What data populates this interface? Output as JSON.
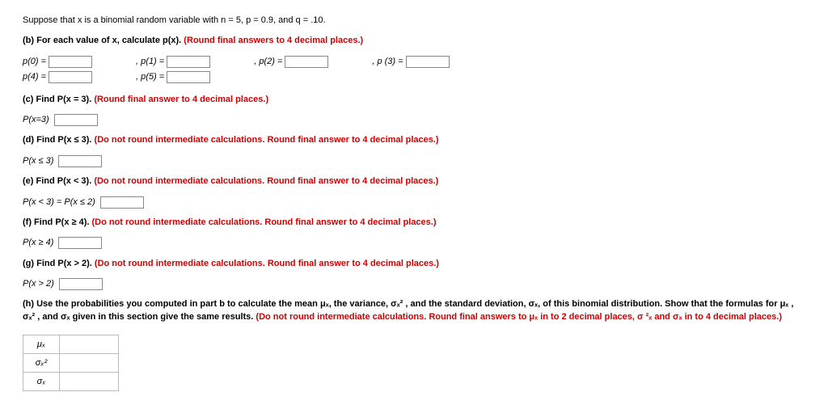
{
  "problem": {
    "intro": "Suppose that x is a binomial random variable with n = 5, p = 0.9, and q = .10.",
    "b": {
      "prompt": "(b) For each value of x, calculate p(x). ",
      "rule": "(Round final answers to 4 decimal places.)",
      "labels": {
        "p0": "p(0) =",
        "p1": ", p(1) =",
        "p2": ", p(2) =",
        "p3": ", p (3) =",
        "p4": "p(4) =",
        "p5": ", p(5) ="
      }
    },
    "c": {
      "prompt": "(c) Find P(x = 3). ",
      "rule": "(Round final answer to 4 decimal places.)",
      "ans_label": "P(x=3)"
    },
    "d": {
      "prompt": "(d) Find P(x ≤ 3). ",
      "rule": "(Do not round intermediate calculations. Round final answer to 4 decimal places.)",
      "ans_label": "P(x ≤ 3)"
    },
    "e": {
      "prompt": "(e) Find P(x < 3). ",
      "rule": "(Do not round intermediate calculations. Round final answer to 4 decimal places.)",
      "ans_label": "P(x < 3) = P(x ≤ 2)"
    },
    "f": {
      "prompt": "(f) Find P(x ≥ 4). ",
      "rule": "(Do not round intermediate calculations. Round final answer to 4 decimal places.)",
      "ans_label": "P(x ≥ 4)"
    },
    "g": {
      "prompt": "(g) Find P(x > 2). ",
      "rule": "(Do not round intermediate calculations. Round final answer to 4 decimal places.)",
      "ans_label": "P(x > 2)"
    },
    "h": {
      "text1": "(h) Use the probabilities you computed in part b to calculate the mean μₓ, the variance, σₓ² , and the standard deviation, σₓ, of this binomial distribution. Show that the formulas for μₓ , σₓ² , and σₓ given in this section give the same results. ",
      "rule": "(Do not round intermediate calculations. Round final answers to μₓ in to 2 decimal places, σ ²ₓ and σₓ in to 4 decimal places.)",
      "rows": {
        "mu": "μₓ",
        "var": "σₓ²",
        "sd": "σₓ"
      }
    }
  }
}
